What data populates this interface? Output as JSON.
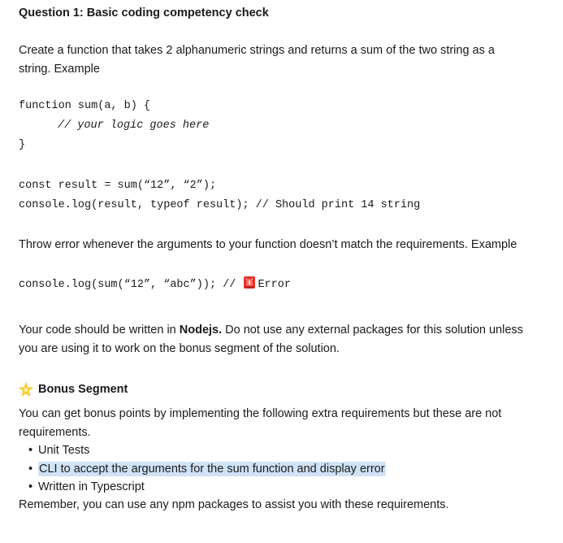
{
  "title": "Question 1: Basic coding competency check",
  "intro_line1": "Create a function that takes 2 alphanumeric strings and returns a sum of the two string as a",
  "intro_line2": "string. Example",
  "code1": {
    "line1": "function sum(a, b) {",
    "line2": "// your logic goes here",
    "line3": "}"
  },
  "code2": {
    "line1": "const result = sum(“12”, “2”);",
    "line2": "console.log(result, typeof result); // Should print 14 string"
  },
  "throw_text": "Throw error whenever the arguments to your function doesn’t match the requirements. Example",
  "code3": {
    "before": "console.log(sum(“12”, “abc”)); // ",
    "after": "Error",
    "icon": "siren-icon"
  },
  "nodejs_para": {
    "line1_pre": "Your code should be written in ",
    "line1_bold": "Nodejs.",
    "line1_post": " Do not use any external packages for this solution unless",
    "line2": "you are using it to work on the bonus segment of the solution."
  },
  "bonus": {
    "icon": "sparkle-star-icon",
    "heading": "Bonus Segment",
    "desc_line1": "You can get bonus points by implementing the following extra requirements but these are not",
    "desc_line2": "requirements.",
    "items": [
      "Unit Tests",
      "CLI to accept the arguments for the sum function and display error",
      "Written in Typescript"
    ],
    "footer": "Remember, you can use any npm packages to assist you with these requirements."
  },
  "colors": {
    "highlight": "#cfe3f7",
    "text": "#1a1a1a"
  }
}
